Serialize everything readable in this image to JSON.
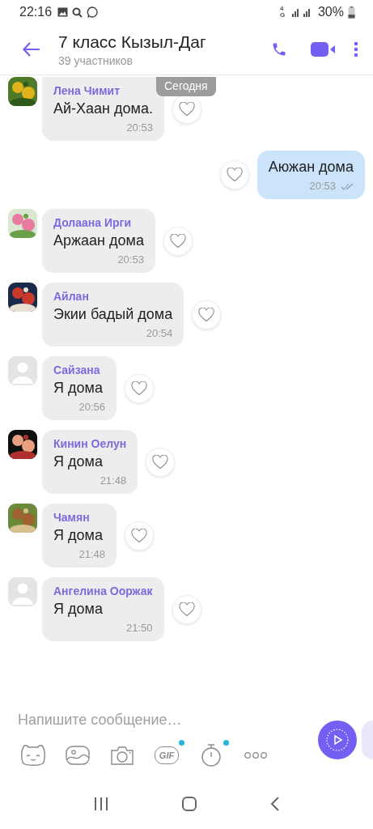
{
  "status_bar": {
    "time": "22:16",
    "network": "4G",
    "battery": "30%"
  },
  "header": {
    "title": "7 класс Кызыл-Даг",
    "subtitle": "39 участников"
  },
  "date_pill": "Сегодня",
  "messages": [
    {
      "kind": "incoming",
      "sender": "Лена Чимит",
      "text": "Ай-Хаан дома.",
      "time": "20:53"
    },
    {
      "kind": "outgoing",
      "text": "Аюжан дома",
      "time": "20:53",
      "read": true
    },
    {
      "kind": "incoming",
      "sender": "Долаана Ирги",
      "text": "Аржаан дома",
      "time": "20:53"
    },
    {
      "kind": "incoming",
      "sender": "Айлан",
      "text": "Экии бадый дома",
      "time": "20:54"
    },
    {
      "kind": "incoming",
      "avatar": {
        "kind": "default"
      },
      "sender": "Сайзана",
      "text": "Я дома",
      "time": "20:56"
    },
    {
      "kind": "incoming",
      "sender": "Кинин Оелун",
      "text": "Я дома",
      "time": "21:48"
    },
    {
      "kind": "incoming",
      "sender": "Чамян",
      "text": "Я дома",
      "time": "21:48"
    },
    {
      "kind": "incoming",
      "avatar": {
        "kind": "default"
      },
      "sender": "Ангелина Ооржак",
      "text": "Я дома",
      "time": "21:50"
    }
  ],
  "composer": {
    "placeholder": "Напишите сообщение…"
  },
  "toolbar": [
    {
      "kind": "sticker",
      "badge": false
    },
    {
      "kind": "gallery",
      "badge": false
    },
    {
      "kind": "camera",
      "badge": false
    },
    {
      "kind": "gif",
      "label": "GIF",
      "badge": true
    },
    {
      "kind": "timer",
      "badge": true
    },
    {
      "kind": "more",
      "badge": false
    }
  ]
}
